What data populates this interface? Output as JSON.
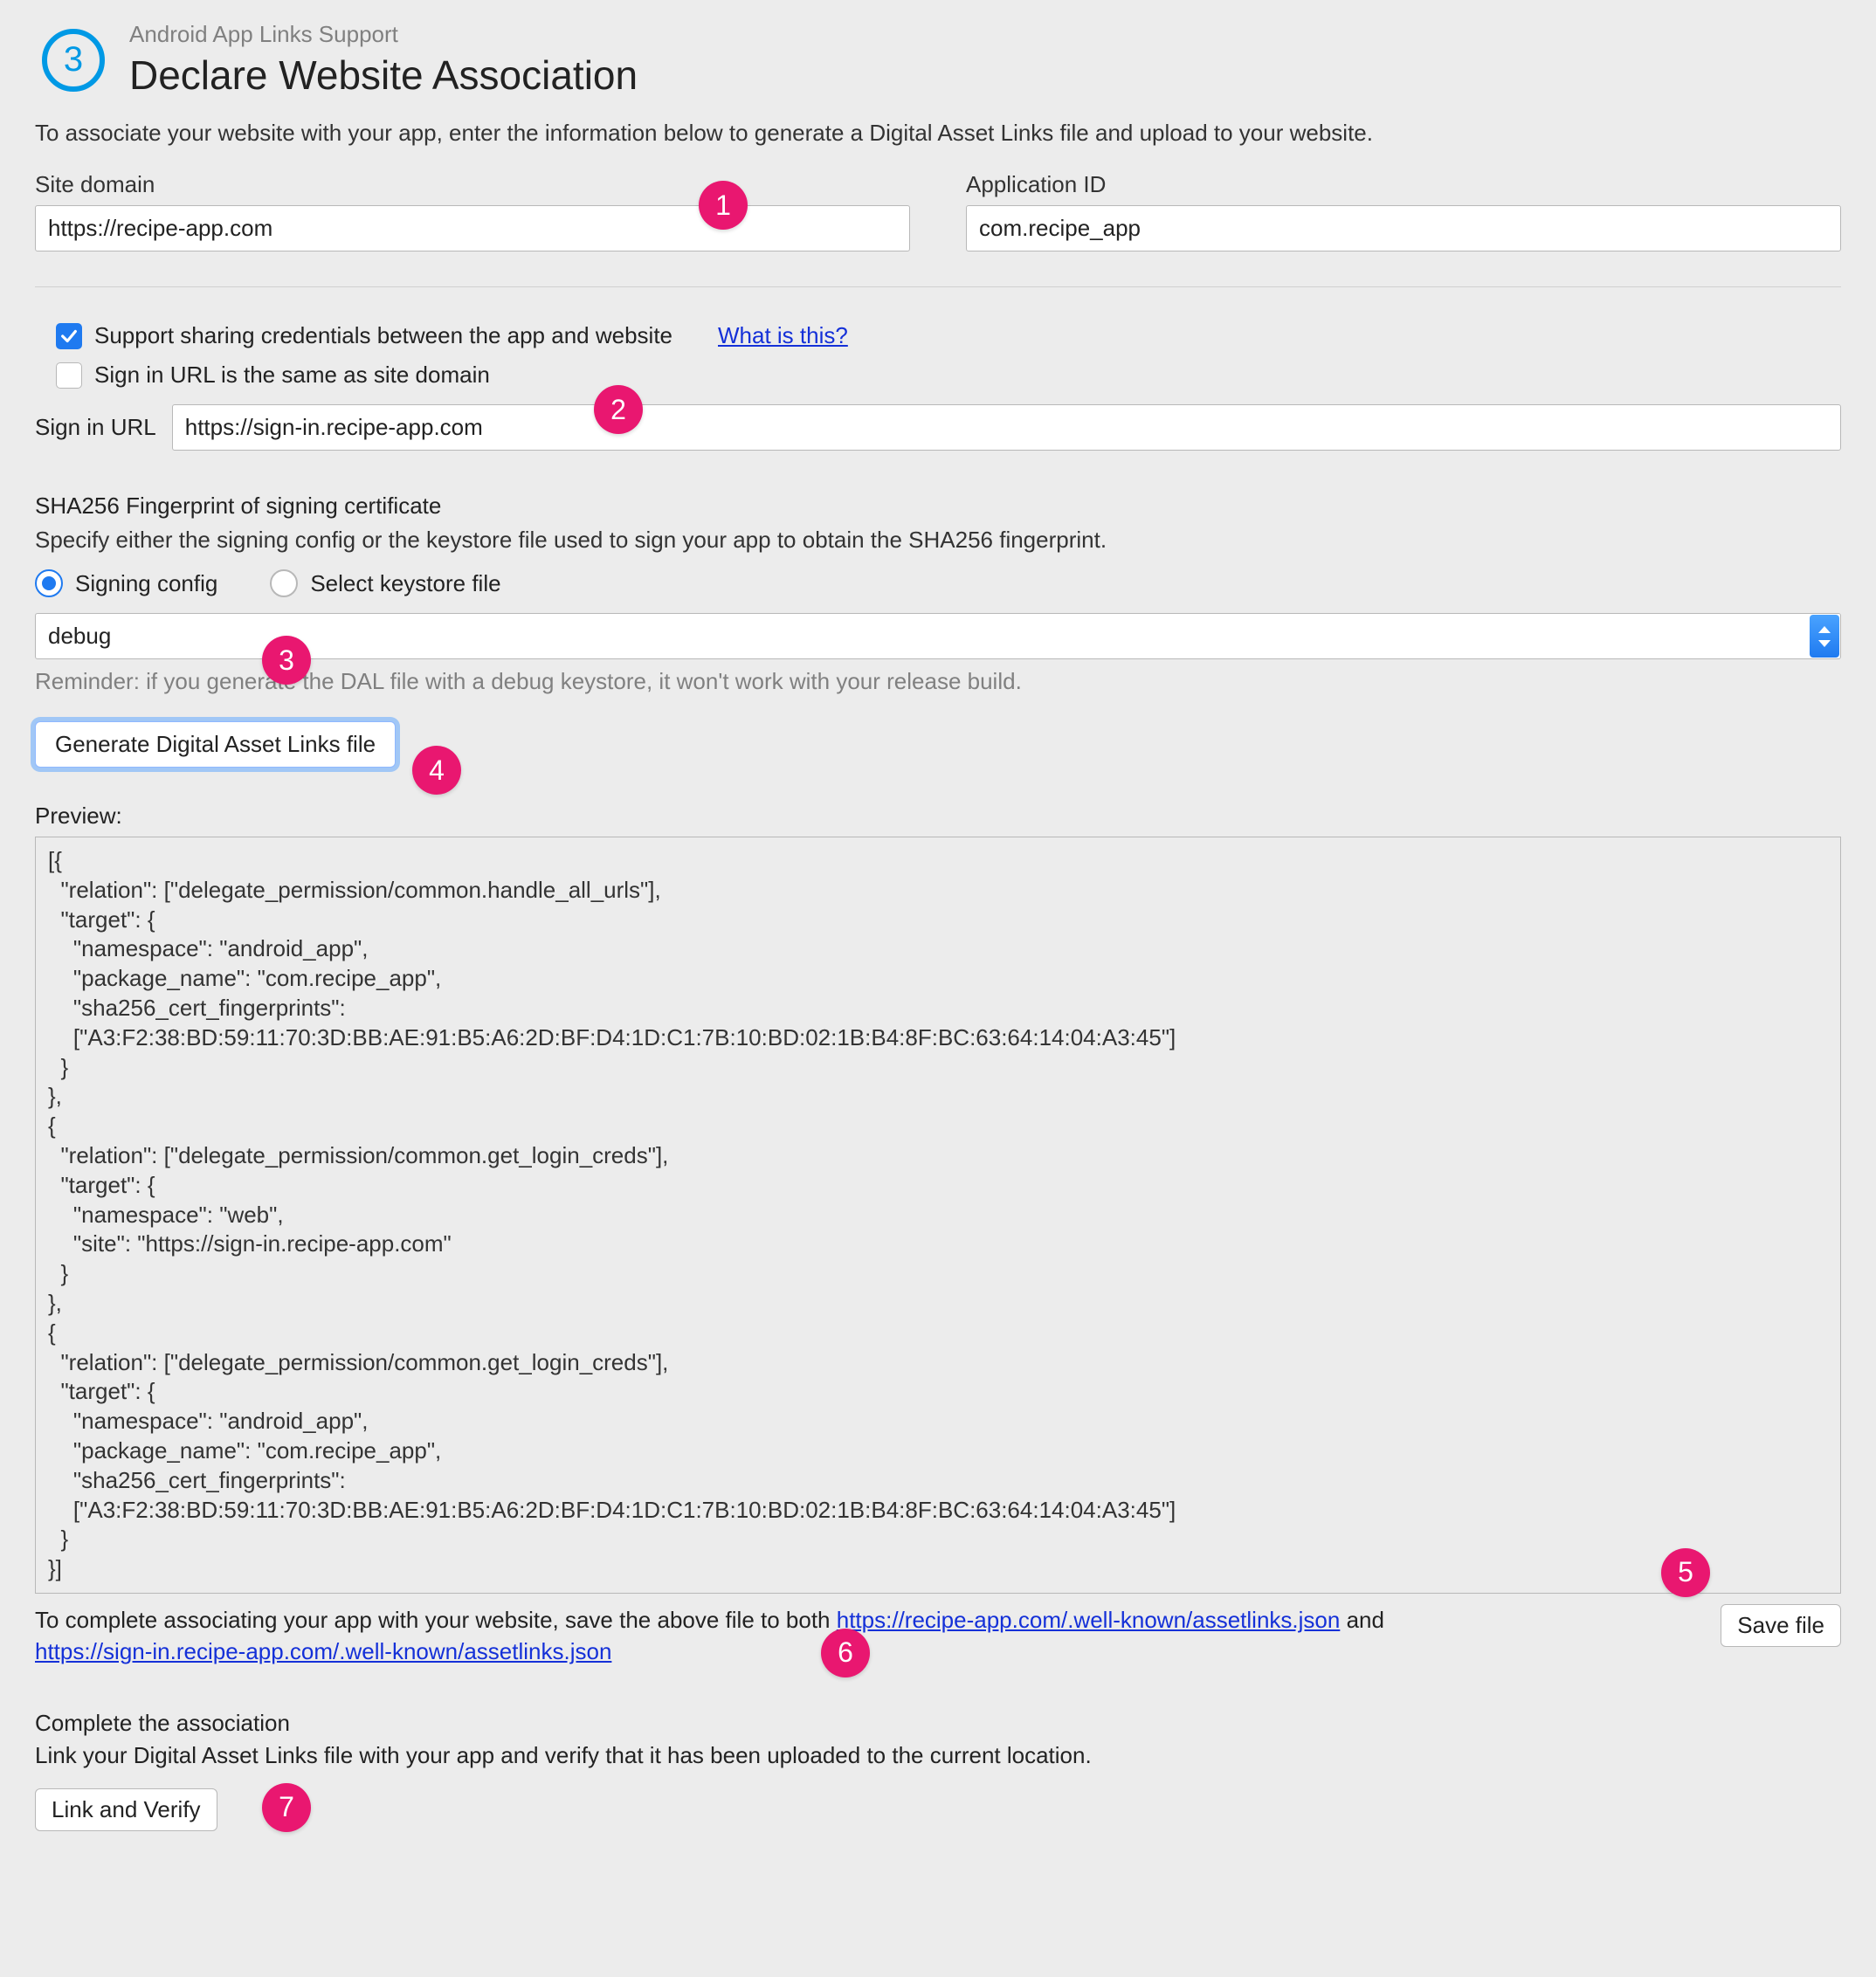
{
  "step_number": "3",
  "header": {
    "overline": "Android App Links Support",
    "title": "Declare Website Association"
  },
  "intro_text": "To associate your website with your app, enter the information below to generate a Digital Asset Links file and upload to your website.",
  "site_domain": {
    "label": "Site domain",
    "value": "https://recipe-app.com"
  },
  "application_id": {
    "label": "Application ID",
    "value": "com.recipe_app"
  },
  "support_sharing": {
    "label": "Support sharing credentials between the app and website",
    "checked": true,
    "help_link": "What is this?"
  },
  "signin_same": {
    "label": "Sign in URL is the same as site domain",
    "checked": false
  },
  "signin_url": {
    "label": "Sign in URL",
    "value": "https://sign-in.recipe-app.com"
  },
  "sha": {
    "title": "SHA256 Fingerprint of signing certificate",
    "desc": "Specify either the signing config or the keystore file used to sign your app to obtain the SHA256 fingerprint.",
    "option_config": "Signing config",
    "option_keystore": "Select keystore file",
    "selected_value": "debug",
    "reminder": "Reminder: if you generate the DAL file with a debug keystore, it won't work with your release build."
  },
  "generate_button": "Generate Digital Asset Links file",
  "preview": {
    "label": "Preview:",
    "text": "[{\n  \"relation\": [\"delegate_permission/common.handle_all_urls\"],\n  \"target\": {\n    \"namespace\": \"android_app\",\n    \"package_name\": \"com.recipe_app\",\n    \"sha256_cert_fingerprints\":\n    [\"A3:F2:38:BD:59:11:70:3D:BB:AE:91:B5:A6:2D:BF:D4:1D:C1:7B:10:BD:02:1B:B4:8F:BC:63:64:14:04:A3:45\"]\n  }\n},\n{\n  \"relation\": [\"delegate_permission/common.get_login_creds\"],\n  \"target\": {\n    \"namespace\": \"web\",\n    \"site\": \"https://sign-in.recipe-app.com\"\n  }\n},\n{\n  \"relation\": [\"delegate_permission/common.get_login_creds\"],\n  \"target\": {\n    \"namespace\": \"android_app\",\n    \"package_name\": \"com.recipe_app\",\n    \"sha256_cert_fingerprints\":\n    [\"A3:F2:38:BD:59:11:70:3D:BB:AE:91:B5:A6:2D:BF:D4:1D:C1:7B:10:BD:02:1B:B4:8F:BC:63:64:14:04:A3:45\"]\n  }\n}]"
  },
  "save": {
    "prefix": "To complete associating your app with your website, save the above file to both ",
    "link1": "https://recipe-app.com/.well-known/assetlinks.json",
    "middle": " and ",
    "link2": "https://sign-in.recipe-app.com/.well-known/assetlinks.json",
    "button": "Save file"
  },
  "complete": {
    "title": "Complete the association",
    "desc": "Link your Digital Asset Links file with your app and verify that it has been uploaded to the current location.",
    "button": "Link and Verify"
  },
  "callouts": [
    "1",
    "2",
    "3",
    "4",
    "5",
    "6",
    "7"
  ]
}
